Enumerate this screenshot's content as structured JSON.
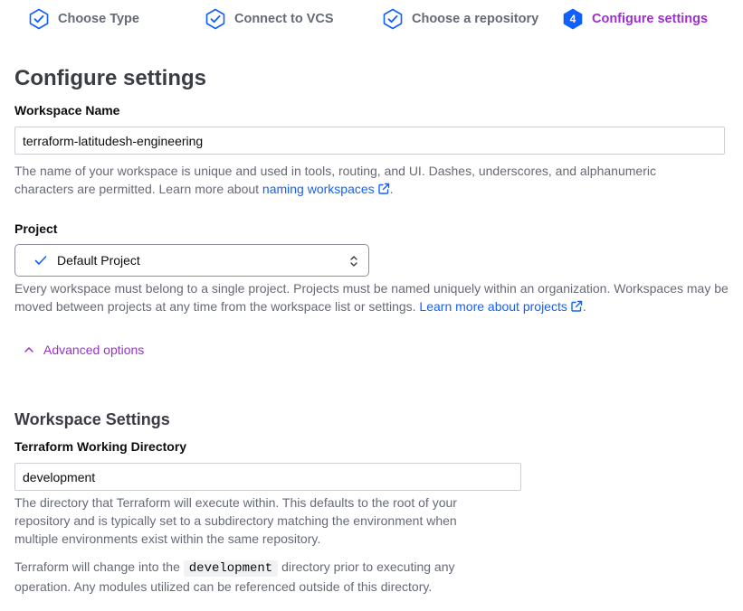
{
  "stepper": {
    "steps": [
      {
        "label": "Choose Type",
        "state": "complete",
        "icon": "check-hexagon-icon"
      },
      {
        "label": "Connect to VCS",
        "state": "complete",
        "icon": "check-hexagon-icon"
      },
      {
        "label": "Choose a repository",
        "state": "complete",
        "icon": "check-hexagon-icon"
      },
      {
        "label": "Configure settings",
        "state": "active",
        "number": "4"
      }
    ]
  },
  "page": {
    "title": "Configure settings"
  },
  "workspace_name": {
    "label": "Workspace Name",
    "value": "terraform-latitudesh-engineering",
    "help_text": "The name of your workspace is unique and used in tools, routing, and UI. Dashes, underscores, and alphanumeric characters are permitted. Learn more about",
    "help_link": "naming workspaces",
    "help_end": "."
  },
  "project": {
    "label": "Project",
    "selected": "Default Project",
    "help_text": "Every workspace must belong to a single project. Projects must be named uniquely within an organization. Workspaces may be moved between projects at any time from the workspace list or settings.",
    "help_link": "Learn more about projects",
    "help_end": "."
  },
  "advanced": {
    "label": "Advanced options",
    "expanded": true
  },
  "workspace_settings": {
    "title": "Workspace Settings",
    "working_dir": {
      "label": "Terraform Working Directory",
      "value": "development",
      "help_text": "The directory that Terraform will execute within. This defaults to the root of your repository and is typically set to a subdirectory matching the environment when multiple environments exist within the same repository.",
      "change_before": "Terraform will change into the",
      "change_code": "development",
      "change_after": "directory prior to executing any operation. Any modules utilized can be referenced outside of this directory."
    }
  },
  "colors": {
    "accent": "#9d2fd1",
    "link": "#1060ff",
    "step_complete": "#1060ff",
    "muted_text": "#656a76"
  }
}
